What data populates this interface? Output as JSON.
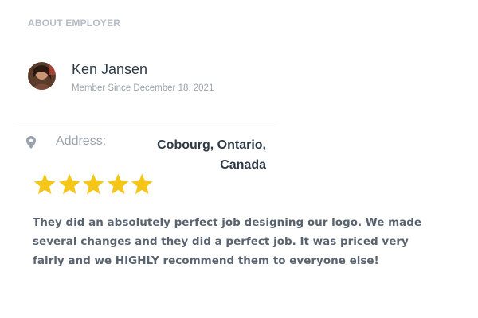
{
  "section": {
    "heading": "ABOUT EMPLOYER"
  },
  "employer": {
    "name": "Ken Jansen",
    "member_since": "Member Since December 18, 2021",
    "avatar_icon": "avatar"
  },
  "address": {
    "label": "Address:",
    "value": "Cobourg, Ontario, Canada",
    "icon": "map-pin-icon"
  },
  "rating": {
    "stars": 5,
    "max": 5,
    "color": "#f5c518"
  },
  "review": {
    "text": "They did an absolutely perfect job designing our logo. We made several changes and they did a perfect job. It was priced very fairly and we HIGHLY recommend them to everyone else!"
  },
  "colors": {
    "heading": "#b5bcc6",
    "name": "#2e3a47",
    "muted": "#9aa3ad",
    "review": "#5a6470",
    "star": "#f5c518"
  }
}
